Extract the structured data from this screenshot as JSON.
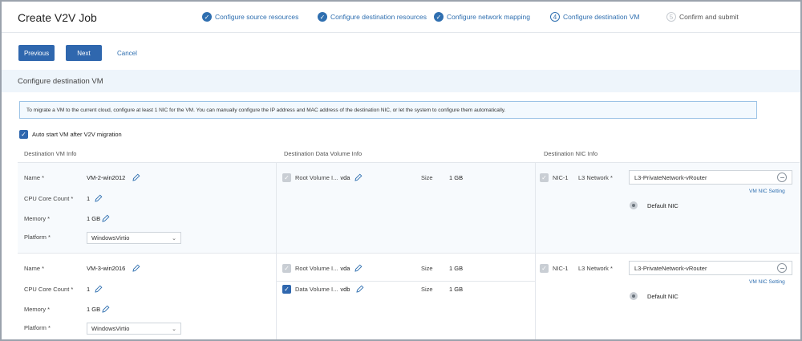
{
  "header": {
    "title": "Create V2V Job",
    "steps": [
      {
        "num": "✓",
        "label": "Configure source resources"
      },
      {
        "num": "✓",
        "label": "Configure destination resources"
      },
      {
        "num": "✓",
        "label": "Configure network mapping"
      },
      {
        "num": "4",
        "label": "Configure destination VM"
      },
      {
        "num": "5",
        "label": "Confirm and submit"
      }
    ]
  },
  "actions": {
    "previous": "Previous",
    "next": "Next",
    "cancel": "Cancel"
  },
  "section": {
    "title": "Configure destination VM",
    "info": "To migrate a VM to the current cloud, configure at least 1 NIC for the VM. You can manually configure the IP address and MAC address of the destination NIC, or let the system to configure them automatically.",
    "auto_start": "Auto start VM after V2V migration"
  },
  "columns": {
    "vm": "Destination VM Info",
    "volume": "Destination Data Volume Info",
    "nic": "Destination NIC Info"
  },
  "labels": {
    "name": "Name *",
    "cpu": "CPU Core Count *",
    "memory": "Memory *",
    "platform": "Platform *",
    "size": "Size",
    "nic": "NIC-1",
    "l3": "L3 Network *",
    "nic_setting": "VM NIC Setting",
    "default_nic": "Default NIC"
  },
  "vms": [
    {
      "name": "VM-2-win2012",
      "cpu": "1",
      "memory": "1 GB",
      "platform": "WindowsVirtio",
      "volumes": [
        {
          "label": "Root Volume I...",
          "dev": "vda",
          "size": "1 GB"
        }
      ],
      "l3_network": "L3-PrivateNetwork-vRouter"
    },
    {
      "name": "VM-3-win2016",
      "cpu": "1",
      "memory": "1 GB",
      "platform": "WindowsVirtio",
      "volumes": [
        {
          "label": "Root Volume I...",
          "dev": "vda",
          "size": "1 GB"
        },
        {
          "label": "Data Volume I...",
          "dev": "vdb",
          "size": "1 GB"
        }
      ],
      "l3_network": "L3-PrivateNetwork-vRouter"
    }
  ],
  "colors": {
    "primary": "#2f67ae",
    "link": "#2f6fb0",
    "section_bg": "#eef5fb"
  }
}
